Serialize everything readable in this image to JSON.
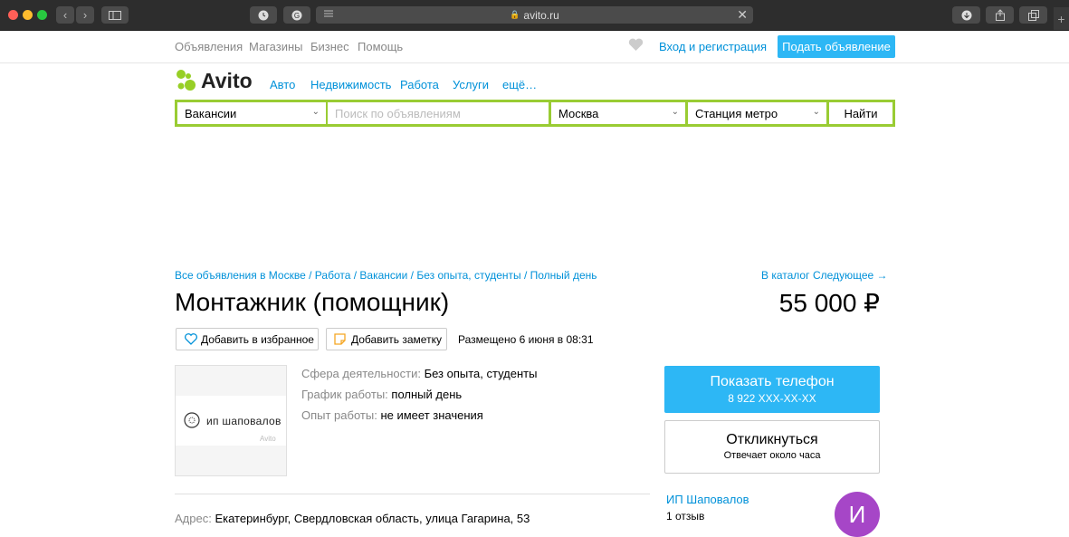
{
  "browser": {
    "url": "avito.ru",
    "traffic_colors": [
      "#ff5f57",
      "#febc2e",
      "#28c840"
    ]
  },
  "topnav": {
    "links": [
      "Объявления",
      "Магазины",
      "Бизнес",
      "Помощь"
    ],
    "login": "Вход и регистрация",
    "post_ad": "Подать объявление"
  },
  "logo": {
    "text": "Avito",
    "colors": [
      "#97cf26",
      "#ff6163",
      "#a169f7",
      "#0af"
    ]
  },
  "categories": [
    "Авто",
    "Недвижимость",
    "Работа",
    "Услуги",
    "ещё…"
  ],
  "search": {
    "category": "Вакансии",
    "placeholder": "Поиск по объявлениям",
    "city": "Москва",
    "metro": "Станция метро",
    "submit": "Найти"
  },
  "breadcrumbs": [
    "Все объявления в Москве",
    "Работа",
    "Вакансии",
    "Без опыта, студенты",
    "Полный день"
  ],
  "nav": {
    "catalog": "В каталог",
    "next": "Следующее →"
  },
  "ad": {
    "title": "Монтажник (помощник)",
    "price": "55 000 ₽",
    "favorite": "Добавить в избранное",
    "note": "Добавить заметку",
    "posted": "Размещено 6 июня в 08:31",
    "photo_text": "ип шаповалов",
    "watermark": "Avito",
    "params": [
      {
        "key": "Сфера деятельности:",
        "value": "Без опыта, студенты"
      },
      {
        "key": "График работы:",
        "value": "полный день"
      },
      {
        "key": "Опыт работы:",
        "value": "не имеет значения"
      }
    ],
    "address_label": "Адрес:",
    "address": "Екатеринбург, Свердловская область, улица Гагарина, 53"
  },
  "contact": {
    "show_phone": "Показать телефон",
    "phone": "8 922 XXX-XX-XX",
    "respond": "Откликнуться",
    "respond_sub": "Отвечает около часа",
    "seller": "ИП Шаповалов",
    "reviews": "1 отзыв",
    "avatar_letter": "И"
  }
}
